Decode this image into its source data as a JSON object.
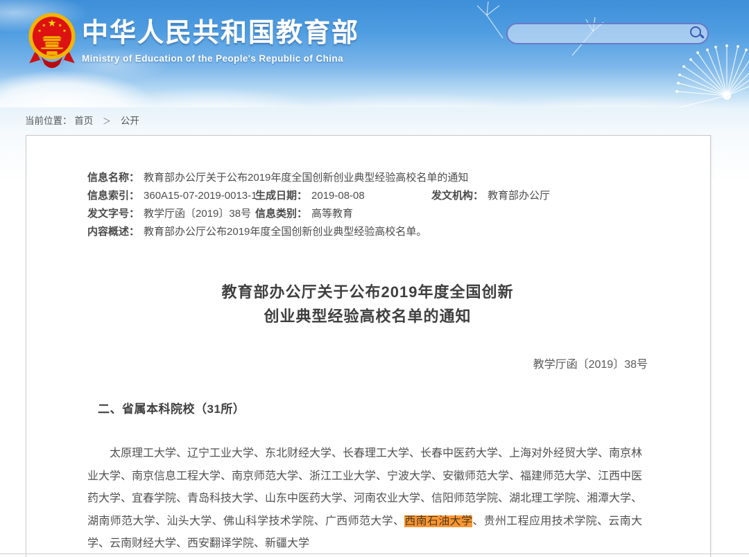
{
  "header": {
    "site_title": "中华人民共和国教育部",
    "site_subtitle": "Ministry of Education of the People's Republic of China",
    "search": {
      "value": "",
      "placeholder": ""
    }
  },
  "breadcrumb": {
    "location_label": "当前位置：",
    "home": "首页",
    "separator": "＞",
    "section": "公开"
  },
  "meta_fields": {
    "name_label": "信息名称：",
    "name_value": "教育部办公厅关于公布2019年度全国创新创业典型经验高校名单的通知",
    "index_label": "信息索引：",
    "index_value": "360A15-07-2019-0013-1",
    "date_label": "生成日期：",
    "date_value": "2019-08-08",
    "agency_label": "发文机构：",
    "agency_value": "教育部办公厅",
    "docno_label": "发文字号：",
    "docno_value": "教学厅函〔2019〕38号",
    "category_label": "信息类别：",
    "category_value": "高等教育",
    "summary_label": "内容概述：",
    "summary_value": "教育部办公厅公布2019年度全国创新创业典型经验高校名单。"
  },
  "document": {
    "title_line1": "教育部办公厅关于公布2019年度全国创新",
    "title_line2": "创业典型经验高校名单的通知",
    "doc_number": "教学厅函〔2019〕38号",
    "section_heading": "二、省属本科院校（31所）",
    "paragraph_before": "太原理工大学、辽宁工业大学、东北财经大学、长春理工大学、长春中医药大学、上海对外经贸大学、南京林业大学、南京信息工程大学、南京师范大学、浙江工业大学、宁波大学、安徽师范大学、福建师范大学、江西中医药大学、宜春学院、青岛科技大学、山东中医药大学、河南农业大学、信阳师范学院、湖北理工学院、湘潭大学、湖南师范大学、汕头大学、佛山科学技术学院、广西师范大学、",
    "paragraph_highlight": "西南石油大学",
    "paragraph_after": "、贵州工程应用技术学院、云南大学、云南财经大学、西安翻译学院、新疆大学"
  },
  "colors": {
    "header_blue": "#3e8fd9",
    "search_border": "#6b79c8",
    "highlight_background": "#ff9632",
    "panel_border": "#c9c9c9",
    "body_text": "#515151"
  }
}
